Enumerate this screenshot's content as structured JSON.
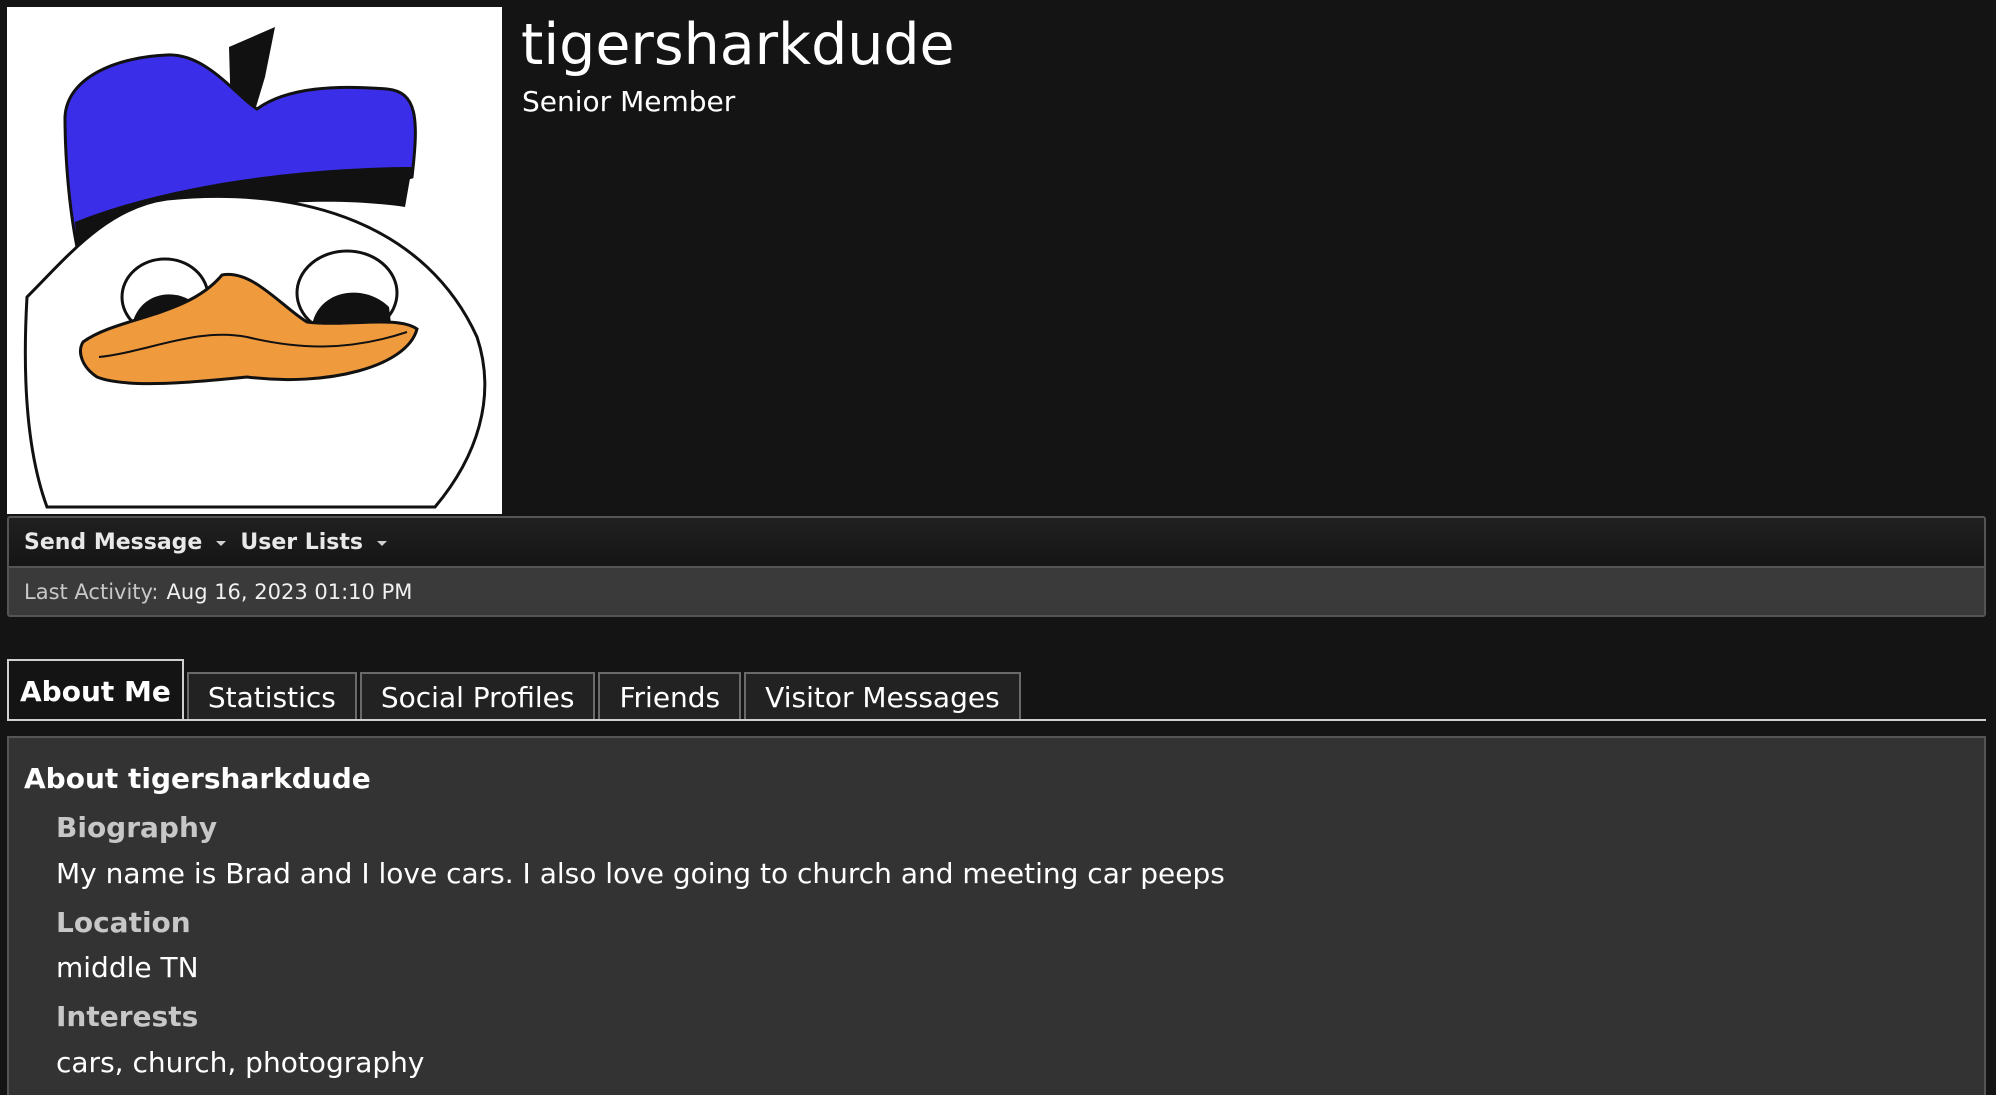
{
  "profile": {
    "username": "tigersharkdude",
    "title": "Senior Member"
  },
  "actions": {
    "send_message": "Send Message",
    "user_lists": "User Lists"
  },
  "activity": {
    "label": "Last Activity:",
    "value": "Aug 16, 2023 01:10 PM"
  },
  "tabs": [
    {
      "label": "About Me",
      "active": true
    },
    {
      "label": "Statistics",
      "active": false
    },
    {
      "label": "Social Profiles",
      "active": false
    },
    {
      "label": "Friends",
      "active": false
    },
    {
      "label": "Visitor Messages",
      "active": false
    }
  ],
  "about": {
    "heading": "About tigersharkdude",
    "fields": [
      {
        "label": "Biography",
        "value": "My name is Brad and I love cars. I also love going to church and meeting car peeps"
      },
      {
        "label": "Location",
        "value": "middle TN"
      },
      {
        "label": "Interests",
        "value": "cars, church, photography"
      }
    ]
  },
  "colors": {
    "background": "#141414",
    "panel": "#333333",
    "hat": "#3a2ee8",
    "beak": "#f09a3e"
  }
}
